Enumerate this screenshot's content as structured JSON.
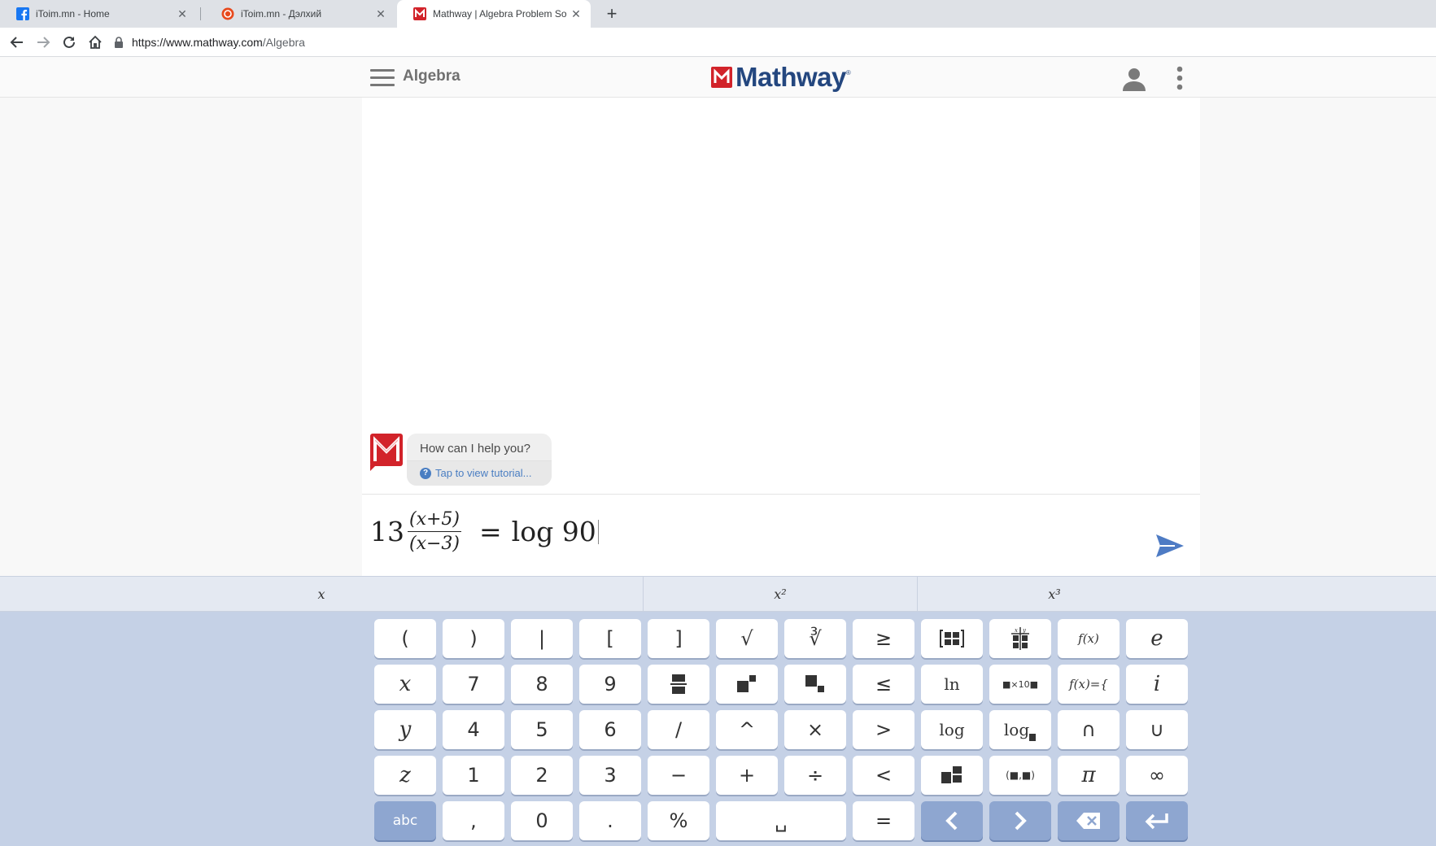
{
  "browser": {
    "tabs": [
      {
        "title": "iToim.mn - Home",
        "favicon": "facebook-icon",
        "active": false
      },
      {
        "title": "iToim.mn - Дэлхий",
        "favicon": "itoim-icon",
        "active": false
      },
      {
        "title": "Mathway | Algebra Problem Solver",
        "favicon": "mathway-icon",
        "active": true
      }
    ],
    "url_host": "https://www.mathway.com",
    "url_path": "/Algebra"
  },
  "header": {
    "subject": "Algebra",
    "logo_text": "Mathway",
    "logo_tm": "®"
  },
  "chat": {
    "question": "How can I help you?",
    "tutorial_link": "Tap to view tutorial..."
  },
  "input": {
    "coefficient": "13",
    "numerator": "(x+5)",
    "denominator": "(x−3)",
    "equals": "=",
    "rhs": "log 90"
  },
  "keyboard": {
    "tabs": [
      "x",
      "x²",
      "x³"
    ],
    "rows": [
      [
        "(",
        ")",
        "|",
        "[",
        "]",
        "√",
        "∛",
        "≥",
        "matrix",
        "table",
        "f(x)",
        "e"
      ],
      [
        "x",
        "7",
        "8",
        "9",
        "fraction",
        "superscript",
        "subscript",
        "≤",
        "ln",
        "sci-notation",
        "f(x)={",
        "i"
      ],
      [
        "y",
        "4",
        "5",
        "6",
        "/",
        "^",
        "×",
        ">",
        "log",
        "log base",
        "∩",
        "∪"
      ],
      [
        "z",
        "1",
        "2",
        "3",
        "−",
        "+",
        "÷",
        "<",
        "mixed-number",
        "interval",
        "π",
        "∞"
      ],
      [
        "abc",
        ",",
        "0",
        ".",
        "%",
        "space",
        "=",
        "left",
        "right",
        "backspace",
        "enter"
      ]
    ],
    "labels": {
      "lparen": "(",
      "rparen": ")",
      "abs": "|",
      "lbracket": "[",
      "rbracket": "]",
      "sqrt": "√",
      "cbrt": "∛",
      "ge": "≥",
      "fx": "f(x)",
      "e": "e",
      "x": "x",
      "seven": "7",
      "eight": "8",
      "nine": "9",
      "le": "≤",
      "ln": "ln",
      "sci": "■×10■",
      "piecewise": "f(x)={",
      "i": "i",
      "y": "y",
      "four": "4",
      "five": "5",
      "six": "6",
      "slash": "/",
      "caret": "^",
      "times": "×",
      "gt": ">",
      "log": "log",
      "logb": "log",
      "intersect": "∩",
      "union": "∪",
      "z": "z",
      "one": "1",
      "two": "2",
      "three": "3",
      "minus": "−",
      "plus": "+",
      "divide": "÷",
      "lt": "<",
      "interval": "(■,■)",
      "pi": "π",
      "infinity": "∞",
      "abc": "abc",
      "comma": ",",
      "zero": "0",
      "dot": ".",
      "percent": "%",
      "space": "␣",
      "equals": "="
    }
  },
  "colors": {
    "brand_blue": "#24477f",
    "brand_red": "#d2232a",
    "keyboard_bg": "#c5d1e6",
    "dark_key": "#8ea6d0",
    "link": "#4a7ec2"
  }
}
